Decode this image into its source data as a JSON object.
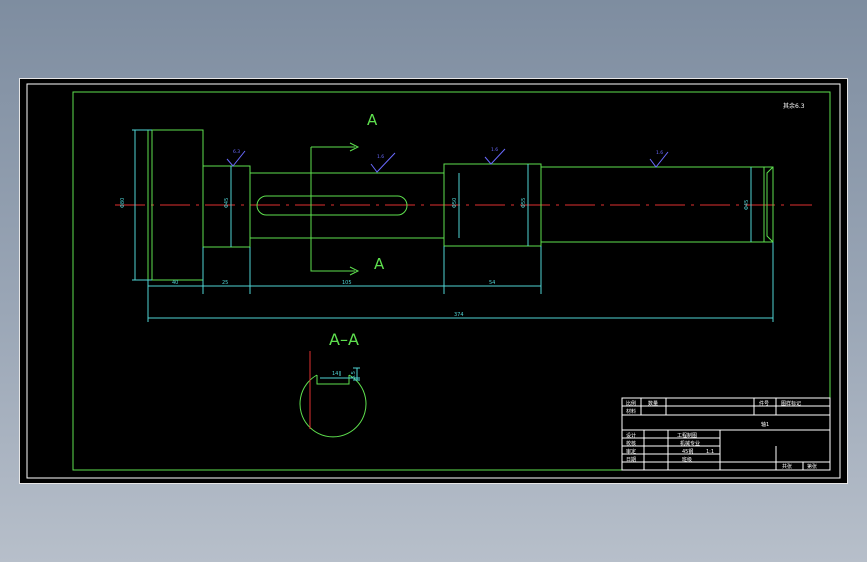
{
  "drawing": {
    "section_letter_top": "A",
    "section_letter_bottom": "A",
    "section_title": "A–A",
    "roughness_note": "其余6.3",
    "part_name": "轴1",
    "roughness_symbols": [
      "6.3",
      "1.6",
      "1.6",
      "1.6"
    ],
    "dimensions": {
      "overall_length": "374",
      "segment_1": "40",
      "segment_2": "25",
      "segment_3": "105",
      "segment_4": "54",
      "dia_head": "Φ80",
      "dia_2": "Φ45",
      "dia_3": "Φ50",
      "dia_4": "Φ55",
      "dia_end": "Φ45",
      "keyway_width": "14",
      "keyway_depth": "5.5"
    }
  },
  "title_block": {
    "hdr_left_1": "比例",
    "hdr_left_2": "数量",
    "hdr_right_1": "件号",
    "hdr_right_2": "图样标记",
    "row_label": "材料",
    "label_design": "设计",
    "label_check": "校核",
    "label_approve": "审定",
    "label_date": "日期",
    "info_1": "工程制图",
    "info_2": "机械专业",
    "info_3": "45钢",
    "info_4": "1:1",
    "info_5": "班级",
    "foot_1": "共张",
    "foot_2": "第张"
  },
  "colors": {
    "background": "#000000",
    "outline": "#5ee04e",
    "dimension": "#4fd4d4",
    "centerline": "#e03030",
    "frame": "#ffffff",
    "roughness": "#6a6aff"
  }
}
